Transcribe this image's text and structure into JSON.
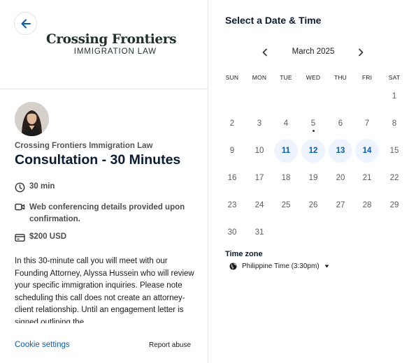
{
  "brand": {
    "name": "Crossing Frontiers",
    "tagline": "IMMIGRATION LAW"
  },
  "event": {
    "organizer": "Crossing Frontiers Immigration Law",
    "title": "Consultation - 30 Minutes",
    "duration": "30 min",
    "location": "Web conferencing details provided upon confirmation.",
    "price": "$200 USD",
    "description": "In this 30-minute call you will meet with our Founding Attorney, Alyssa Hussein who will review your specific immigration inquiries. Please note scheduling this call does not create an attorney-client relationship. Until an engagement letter is signed outlining the"
  },
  "footer": {
    "cookie_settings": "Cookie settings",
    "report_abuse": "Report abuse"
  },
  "calendar": {
    "heading": "Select a Date & Time",
    "month": "March 2025",
    "weekdays": [
      "SUN",
      "MON",
      "TUE",
      "WED",
      "THU",
      "FRI",
      "SAT"
    ],
    "weeks": [
      [
        "",
        "",
        "",
        "",
        "",
        "",
        "1"
      ],
      [
        "2",
        "3",
        "4",
        "5",
        "6",
        "7",
        "8"
      ],
      [
        "9",
        "10",
        "11",
        "12",
        "13",
        "14",
        "15"
      ],
      [
        "16",
        "17",
        "18",
        "19",
        "20",
        "21",
        "22"
      ],
      [
        "23",
        "24",
        "25",
        "26",
        "27",
        "28",
        "29"
      ],
      [
        "30",
        "31",
        "",
        "",
        "",
        "",
        ""
      ]
    ],
    "available_days": [
      "11",
      "12",
      "13",
      "14"
    ],
    "today": "5"
  },
  "timezone": {
    "label": "Time zone",
    "value": "Philippine Time (3:30pm)"
  },
  "colors": {
    "accent": "#0b5cad",
    "available_bg": "#eef4fd",
    "title": "#0a1b33"
  },
  "icons": {
    "back": "arrow-left-icon",
    "duration": "clock-icon",
    "location": "video-camera-icon",
    "price": "credit-card-icon",
    "prev_month": "chevron-left-icon",
    "next_month": "chevron-right-icon",
    "timezone": "globe-icon",
    "timezone_dropdown": "caret-down-icon"
  }
}
